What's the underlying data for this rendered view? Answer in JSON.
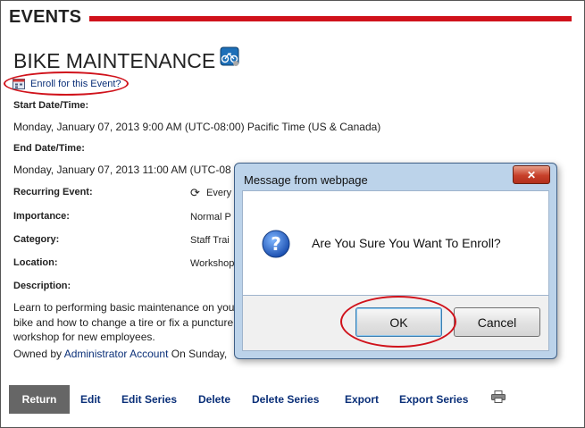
{
  "header": {
    "title": "EVENTS"
  },
  "event": {
    "title": "BIKE MAINTENANCE",
    "enroll_link": "Enroll for this Event?",
    "start_label": "Start Date/Time:",
    "start_value": "Monday, January 07, 2013 9:00 AM (UTC-08:00) Pacific Time (US & Canada)",
    "end_label": "End Date/Time:",
    "end_value": "Monday, January 07, 2013 11:00 AM (UTC-08",
    "recurring_label": "Recurring Event:",
    "recurring_value": "Every",
    "importance_label": "Importance:",
    "importance_value": "Normal P",
    "category_label": "Category:",
    "category_value": "Staff Trai",
    "location_label": "Location:",
    "location_value": "Workshop",
    "description_label": "Description:",
    "description_lines": [
      "Learn to performing basic maintenance on you",
      "bike and how to change a tire or fix a puncture",
      "workshop for new employees."
    ],
    "owned_prefix": "Owned by",
    "owned_link": "Administrator Account",
    "owned_suffix": "On Sunday,"
  },
  "toolbar": {
    "return": "Return",
    "edit": "Edit",
    "edit_series": "Edit Series",
    "delete": "Delete",
    "delete_series": "Delete Series",
    "export": "Export",
    "export_series": "Export Series"
  },
  "dialog": {
    "title": "Message from webpage",
    "message": "Are You Sure You Want To Enroll?",
    "ok": "OK",
    "cancel": "Cancel",
    "close": "✕"
  },
  "icons": {
    "bike": "bike-icon",
    "enroll": "enroll-icon",
    "recurring": "recurring-icon",
    "print": "printer-icon",
    "question": "question-icon"
  },
  "colors": {
    "accent_red": "#d0121b",
    "link_blue": "#0a2f78",
    "dialog_frame": "#bcd3ea"
  }
}
